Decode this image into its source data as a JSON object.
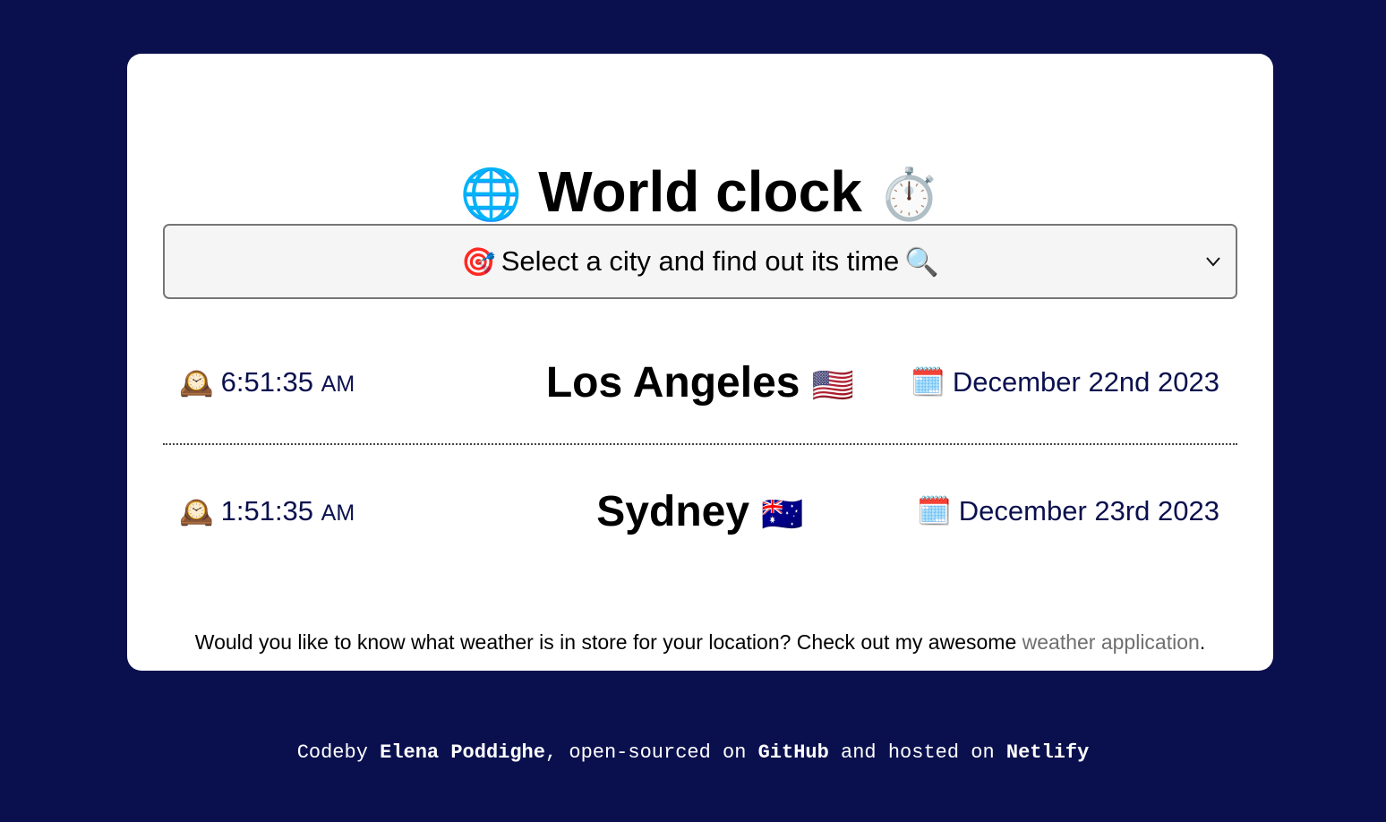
{
  "header": {
    "title": "World clock",
    "title_icon_left": "🌐",
    "title_icon_right": "⏱️"
  },
  "city_select": {
    "selected_label": "Select a city and find out its time",
    "icon_left": "🎯",
    "icon_right": "🔍"
  },
  "cities": [
    {
      "clock_icon": "🕰️",
      "time": "6:51:35",
      "ampm": "AM",
      "name": "Los Angeles",
      "flag": "🇺🇸",
      "calendar_icon": "🗓️",
      "date": "December 22nd 2023"
    },
    {
      "clock_icon": "🕰️",
      "time": "1:51:35",
      "ampm": "AM",
      "name": "Sydney",
      "flag": "🇦🇺",
      "calendar_icon": "🗓️",
      "date": "December 23rd 2023"
    }
  ],
  "promo": {
    "text": "Would you like to know what weather is in store for your location? Check out my awesome ",
    "link_label": "weather application",
    "end": "."
  },
  "footer": {
    "prefix": "Codeby ",
    "author": "Elena Poddighe",
    "middle1": ", open-sourced on ",
    "github": "GitHub",
    "middle2": " and hosted on ",
    "netlify": "Netlify"
  },
  "colors": {
    "background": "#0a104e",
    "card": "#ffffff",
    "accent_text": "#0a104e",
    "link": "#6f6f6f"
  }
}
